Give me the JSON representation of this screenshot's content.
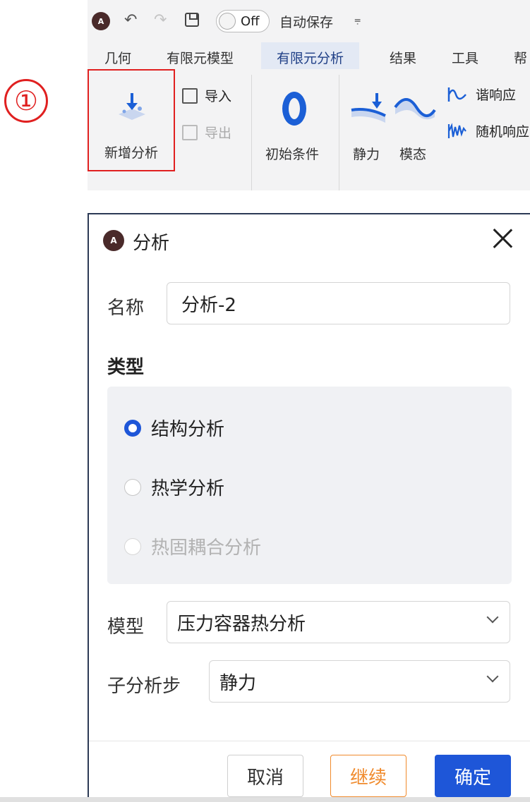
{
  "callout": {
    "number": "①"
  },
  "quick_access": {
    "logo": "A",
    "undo_icon": "undo-icon",
    "redo_icon": "redo-icon",
    "save_icon": "save-icon",
    "toggle_label": "Off",
    "autosave_label": "自动保存",
    "more_icon": "⩦"
  },
  "tabs": [
    "几何",
    "有限元模型",
    "有限元分析",
    "结果",
    "工具",
    "帮"
  ],
  "active_tab_index": 2,
  "ribbon": {
    "new_analysis_label": "新增分析",
    "import_label": "导入",
    "export_label": "导出",
    "initial_conditions_label": "初始条件",
    "static_label": "静力",
    "modal_label": "模态",
    "harmonic_label": "谐响应",
    "random_label": "随机响应"
  },
  "dialog": {
    "title": "分析",
    "name_label": "名称",
    "name_value": "分析-2",
    "type_section": "类型",
    "types": [
      {
        "label": "结构分析",
        "checked": true,
        "disabled": false
      },
      {
        "label": "热学分析",
        "checked": false,
        "disabled": false
      },
      {
        "label": "热固耦合分析",
        "checked": false,
        "disabled": true
      }
    ],
    "model_label": "模型",
    "model_value": "压力容器热分析",
    "substep_label": "子分析步",
    "substep_value": "静力",
    "cancel_label": "取消",
    "continue_label": "继续",
    "ok_label": "确定"
  },
  "colors": {
    "accent": "#1e56d8",
    "highlight": "#e02020",
    "continue": "#f08a2c"
  }
}
